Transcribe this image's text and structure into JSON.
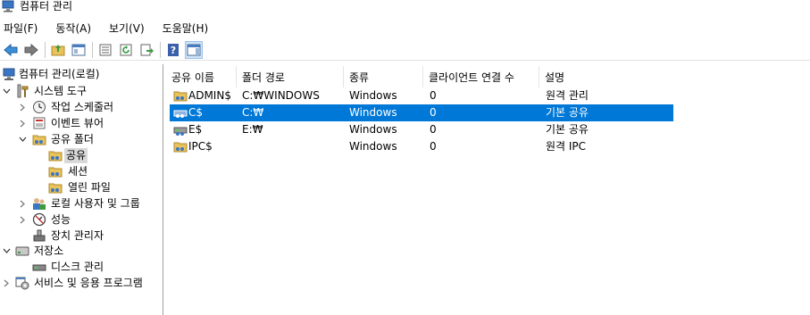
{
  "window": {
    "title": "컴퓨터 관리"
  },
  "menu": [
    "파일(F)",
    "동작(A)",
    "보기(V)",
    "도움말(H)"
  ],
  "toolbar": {
    "buttons": [
      "back-icon",
      "forward-icon",
      "up-folder-icon",
      "show-hide-tree-icon",
      "properties-icon",
      "refresh-icon",
      "export-list-icon",
      "help-icon",
      "show-hide-action-pane-icon"
    ]
  },
  "tree": {
    "root": "컴퓨터 관리(로컬)",
    "system_tools": "시스템 도구",
    "task_scheduler": "작업 스케줄러",
    "event_viewer": "이벤트 뷰어",
    "shared_folders": "공유 폴더",
    "shares": "공유",
    "sessions": "세션",
    "open_files": "열린 파일",
    "local_users_groups": "로컬 사용자 및 그룹",
    "performance": "성능",
    "device_manager": "장치 관리자",
    "storage": "저장소",
    "disk_management": "디스크 관리",
    "services_apps": "서비스 및 응용 프로그램"
  },
  "list": {
    "columns": [
      "공유 이름",
      "폴더 경로",
      "종류",
      "클라이언트 연결 수",
      "설명"
    ],
    "rows": [
      {
        "name": "ADMIN$",
        "path": "C:₩WINDOWS",
        "type": "Windows",
        "clients": "0",
        "desc": "원격 관리",
        "selected": false
      },
      {
        "name": "C$",
        "path": "C:₩",
        "type": "Windows",
        "clients": "0",
        "desc": "기본 공유",
        "selected": true
      },
      {
        "name": "E$",
        "path": "E:₩",
        "type": "Windows",
        "clients": "0",
        "desc": "기본 공유",
        "selected": false
      },
      {
        "name": "IPC$",
        "path": "",
        "type": "Windows",
        "clients": "0",
        "desc": "원격 IPC",
        "selected": false
      }
    ]
  },
  "colors": {
    "selection": "#0078d7",
    "tree_selection": "#d9d9d9",
    "folder": "#e8c25a"
  }
}
